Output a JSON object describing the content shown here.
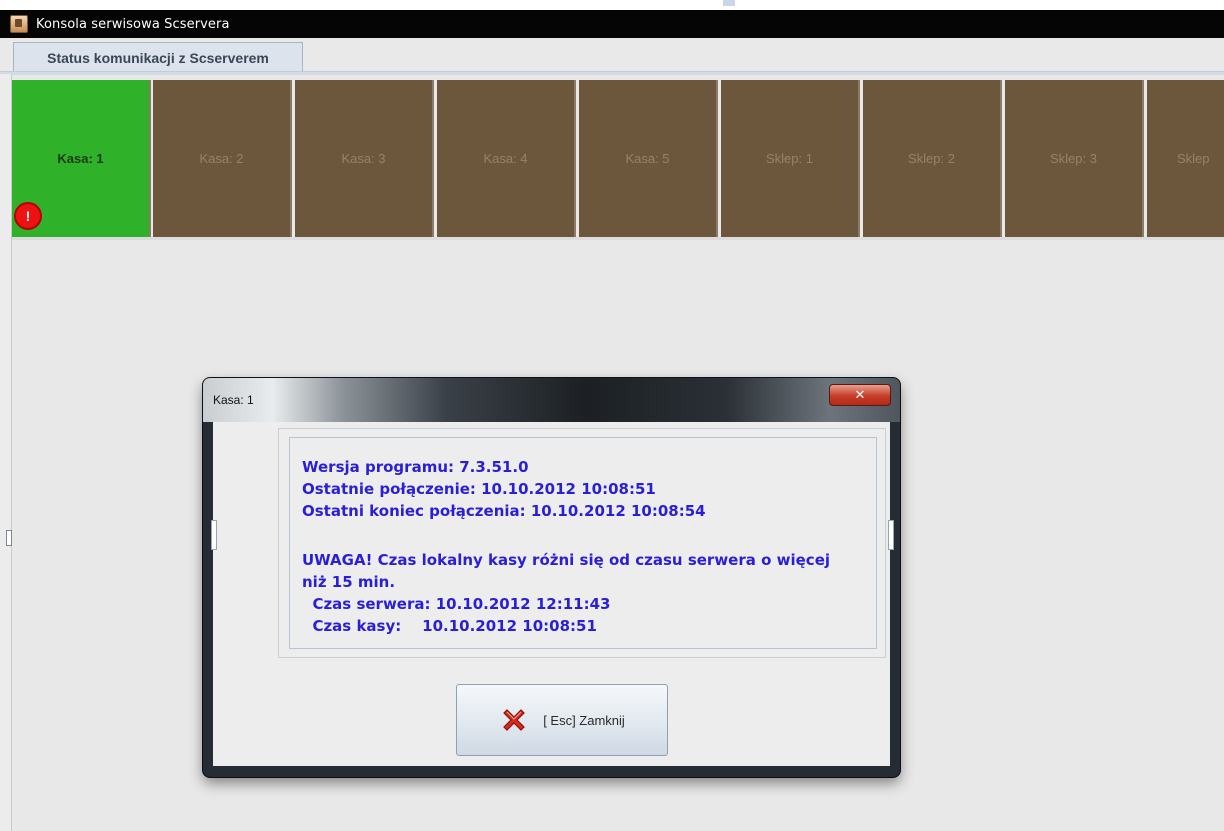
{
  "window": {
    "title": "Konsola serwisowa Scservera"
  },
  "tabs": [
    {
      "label": "Status komunikacji z Scserverem"
    }
  ],
  "tiles": [
    {
      "label": "Kasa: 1",
      "status": "connected",
      "color": "#2fb22a",
      "alert": "!"
    },
    {
      "label": "Kasa: 2",
      "status": "disconnected",
      "color": "#6c573d"
    },
    {
      "label": "Kasa: 3",
      "status": "disconnected",
      "color": "#6c573d"
    },
    {
      "label": "Kasa: 4",
      "status": "disconnected",
      "color": "#6c573d"
    },
    {
      "label": "Kasa: 5",
      "status": "disconnected",
      "color": "#6c573d"
    },
    {
      "label": "Sklep: 1",
      "status": "disconnected",
      "color": "#6c573d"
    },
    {
      "label": "Sklep: 2",
      "status": "disconnected",
      "color": "#6c573d"
    },
    {
      "label": "Sklep: 3",
      "status": "disconnected",
      "color": "#6c573d"
    },
    {
      "label": "Sklep",
      "status": "disconnected",
      "color": "#6c573d"
    }
  ],
  "dialog": {
    "title": "Kasa: 1",
    "close_icon": "close-x-icon",
    "message": {
      "version": "Wersja programu: 7.3.51.0",
      "last_connection": "Ostatnie połączenie: 10.10.2012 10:08:51",
      "last_connection_end": "Ostatni koniec połączenia: 10.10.2012 10:08:54",
      "warning_line1": "UWAGA! Czas lokalny kasy różni się od czasu serwera o więcej",
      "warning_line2": "niż 15 min.",
      "server_time": "  Czas serwera: 10.10.2012 12:11:43",
      "register_time": "  Czas kasy:    10.10.2012 10:08:51"
    },
    "close_button": {
      "label": "[ Esc] Zamknij",
      "icon": "red-x-icon"
    }
  },
  "colors": {
    "message_text": "#2a1fd6",
    "connected": "#2fb22a",
    "disconnected": "#6c573d",
    "alert": "#ef1212"
  }
}
